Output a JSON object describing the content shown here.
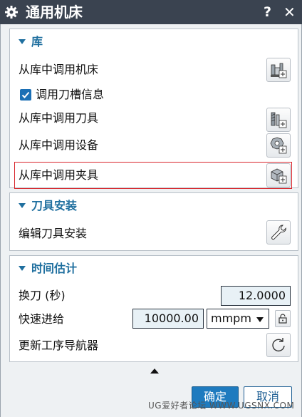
{
  "window": {
    "title": "通用机床",
    "help_label": "?",
    "close_label": "✕",
    "title_icon": "gear-icon"
  },
  "library": {
    "header": "库",
    "retrieve_machine": "从库中调用机床",
    "retrieve_pocket_info": "调用刀槽信息",
    "retrieve_pocket_info_checked": true,
    "retrieve_tool": "从库中调用刀具",
    "retrieve_device": "从库中调用设备",
    "retrieve_fixture": "从库中调用夹具",
    "icons": [
      "machine-library-icon",
      "tool-library-icon",
      "device-library-icon",
      "fixture-library-icon"
    ],
    "highlight_color": "#d9262c"
  },
  "tool_mount": {
    "header": "刀具安装",
    "edit_tool_mount": "编辑刀具安装",
    "icon": "wrench-icon"
  },
  "time_estimate": {
    "header": "时间估计",
    "tool_change_label": "换刀 (秒)",
    "tool_change_value": "12.0000",
    "rapid_feed_label": "快速进给",
    "rapid_feed_value": "10000.00",
    "rapid_feed_unit": "mmpm",
    "update_navigator_label": "更新工序导航器",
    "icons": [
      "lock-icon",
      "refresh-icon"
    ]
  },
  "footer": {
    "ok_label": "确定",
    "cancel_label": "取消",
    "watermark": "UG爱好者论坛 WWW.UGSNX.COM"
  },
  "colors": {
    "titlebar": "#3a4350",
    "section_header": "#1f6f9f",
    "ok_button": "#1e7bbf"
  }
}
